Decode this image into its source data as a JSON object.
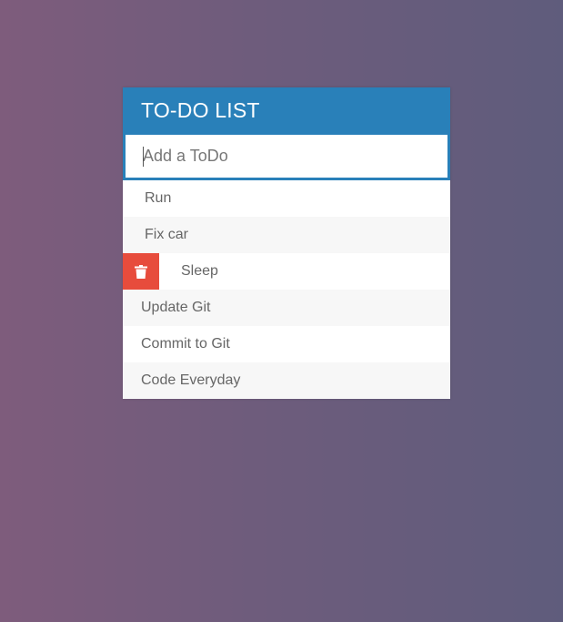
{
  "header": {
    "title": "TO-DO LIST"
  },
  "input": {
    "placeholder": "Add a ToDo",
    "value": ""
  },
  "todos": [
    {
      "label": "Run"
    },
    {
      "label": "Fix car"
    },
    {
      "label": "Sleep",
      "delete_visible": true,
      "delete_icon": "trash-icon"
    },
    {
      "label": "Update Git"
    },
    {
      "label": "Commit to Git"
    },
    {
      "label": "Code Everyday"
    }
  ],
  "colors": {
    "header_bg": "#2980b9",
    "delete_bg": "#e74c3c",
    "text": "#666666"
  }
}
